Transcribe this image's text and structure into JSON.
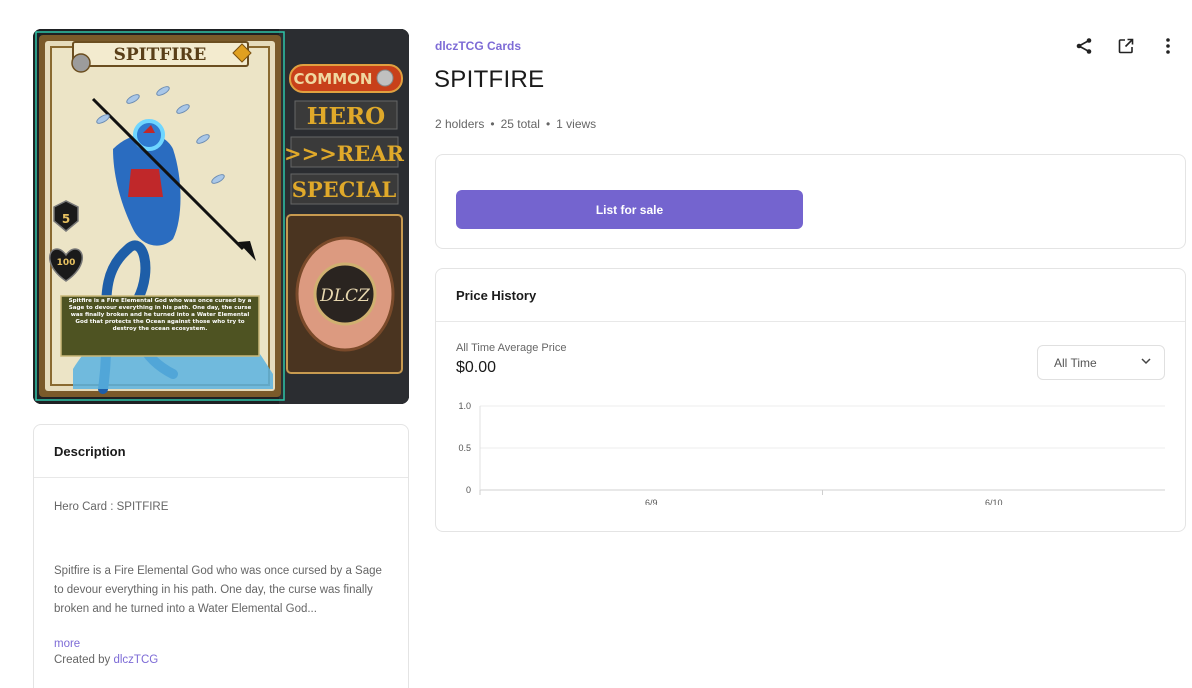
{
  "card": {
    "name": "SPITFIRE",
    "rarity": "COMMON",
    "type": "HERO",
    "position": ">>>REAR",
    "ability": "SPECIAL",
    "level": "5",
    "health": "100",
    "back_logo": "DLCZ",
    "lore": "Spitfire is a Fire Elemental God who was once cursed by a Sage to devour everything in his path. One day, the curse was finally broken and he turned into a Water Elemental God that protects the Ocean against those who try to destroy the ocean ecosystem."
  },
  "collection": "dlczTCG Cards",
  "title": "SPITFIRE",
  "stats": {
    "holders": "2 holders",
    "total": "25 total",
    "views": "1 views",
    "separator": "•"
  },
  "actions": {
    "share_icon": "share-icon",
    "open_icon": "external-link-icon",
    "more_icon": "more-vertical-icon"
  },
  "sale": {
    "button_label": "List for sale",
    "button_color": "#7464cf"
  },
  "price_history": {
    "heading": "Price History",
    "avg_label": "All Time Average Price",
    "avg_value": "$0.00",
    "time_filter": "All Time"
  },
  "chart_data": {
    "type": "line",
    "title": "",
    "xlabel": "",
    "ylabel": "",
    "categories": [
      "6/9",
      "6/10"
    ],
    "series": [],
    "y_ticks": [
      "1.0",
      "0.5",
      "0"
    ],
    "ylim": [
      0,
      1
    ],
    "grid": true
  },
  "description": {
    "heading": "Description",
    "line1": "Hero Card : SPITFIRE",
    "body": "Spitfire is a Fire Elemental God who was once cursed by a Sage to devour everything in his path. One day, the curse was finally broken and he turned into a Water Elemental God...",
    "more": "more",
    "created_by": "Created by",
    "creator": "dlczTCG"
  },
  "colors": {
    "accent": "#7d6bd6",
    "button": "#7464cf"
  }
}
